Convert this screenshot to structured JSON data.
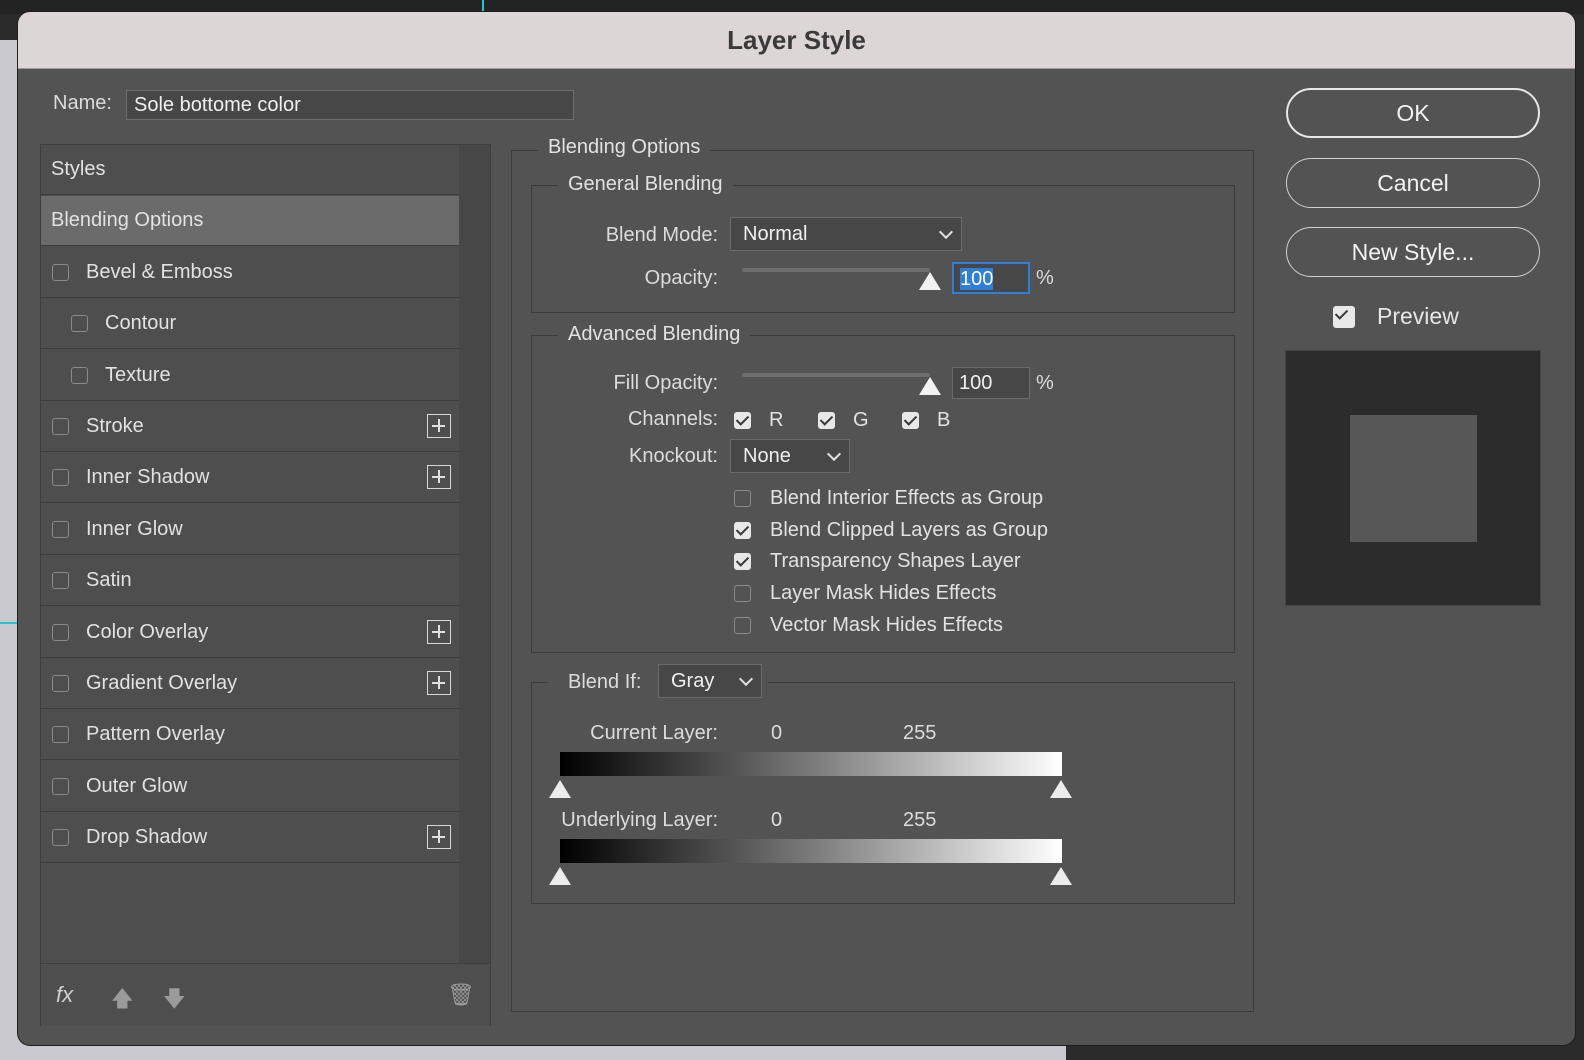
{
  "dialog": {
    "title": "Layer Style"
  },
  "name_field": {
    "label": "Name:",
    "value": "Sole bottome color"
  },
  "styles_list": {
    "items": [
      {
        "label": "Styles",
        "checkbox": false,
        "selected": false,
        "indent": false,
        "plus": false
      },
      {
        "label": "Blending Options",
        "checkbox": false,
        "selected": true,
        "indent": false,
        "plus": false
      },
      {
        "label": "Bevel & Emboss",
        "checkbox": true,
        "checked": false,
        "indent": false,
        "plus": false
      },
      {
        "label": "Contour",
        "checkbox": true,
        "checked": false,
        "indent": true,
        "plus": false
      },
      {
        "label": "Texture",
        "checkbox": true,
        "checked": false,
        "indent": true,
        "plus": false
      },
      {
        "label": "Stroke",
        "checkbox": true,
        "checked": false,
        "indent": false,
        "plus": true
      },
      {
        "label": "Inner Shadow",
        "checkbox": true,
        "checked": false,
        "indent": false,
        "plus": true
      },
      {
        "label": "Inner Glow",
        "checkbox": true,
        "checked": false,
        "indent": false,
        "plus": false
      },
      {
        "label": "Satin",
        "checkbox": true,
        "checked": false,
        "indent": false,
        "plus": false
      },
      {
        "label": "Color Overlay",
        "checkbox": true,
        "checked": false,
        "indent": false,
        "plus": true
      },
      {
        "label": "Gradient Overlay",
        "checkbox": true,
        "checked": false,
        "indent": false,
        "plus": true
      },
      {
        "label": "Pattern Overlay",
        "checkbox": true,
        "checked": false,
        "indent": false,
        "plus": false
      },
      {
        "label": "Outer Glow",
        "checkbox": true,
        "checked": false,
        "indent": false,
        "plus": false
      },
      {
        "label": "Drop Shadow",
        "checkbox": true,
        "checked": false,
        "indent": false,
        "plus": true
      }
    ],
    "footer": {
      "fx_label": "fx"
    }
  },
  "blending": {
    "section_title": "Blending Options",
    "general": {
      "title": "General Blending",
      "blend_mode_label": "Blend Mode:",
      "blend_mode_value": "Normal",
      "opacity_label": "Opacity:",
      "opacity_value": "100",
      "opacity_unit": "%",
      "opacity_level": 100
    },
    "advanced": {
      "title": "Advanced Blending",
      "fill_opacity_label": "Fill Opacity:",
      "fill_opacity_value": "100",
      "fill_opacity_unit": "%",
      "fill_opacity_level": 100,
      "channels_label": "Channels:",
      "channels": [
        {
          "label": "R",
          "checked": true
        },
        {
          "label": "G",
          "checked": true
        },
        {
          "label": "B",
          "checked": true
        }
      ],
      "knockout_label": "Knockout:",
      "knockout_value": "None",
      "options": [
        {
          "label": "Blend Interior Effects as Group",
          "checked": false
        },
        {
          "label": "Blend Clipped Layers as Group",
          "checked": true
        },
        {
          "label": "Transparency Shapes Layer",
          "checked": true
        },
        {
          "label": "Layer Mask Hides Effects",
          "checked": false
        },
        {
          "label": "Vector Mask Hides Effects",
          "checked": false
        }
      ]
    },
    "blend_if": {
      "label": "Blend If:",
      "value": "Gray",
      "current_layer": {
        "label": "Current Layer:",
        "low": "0",
        "high": "255"
      },
      "underlying_layer": {
        "label": "Underlying Layer:",
        "low": "0",
        "high": "255"
      }
    }
  },
  "buttons": {
    "ok": "OK",
    "cancel": "Cancel",
    "new_style": "New Style..."
  },
  "preview": {
    "label": "Preview",
    "checked": true
  },
  "colors": {
    "dialog_bg": "#535353",
    "title_bg": "#dcd6d6",
    "focus": "#2f7fd8",
    "selected_row": "#6b6b6b"
  }
}
